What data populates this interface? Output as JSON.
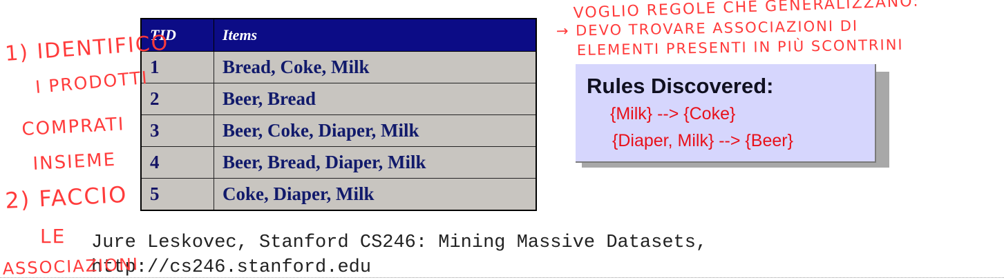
{
  "table": {
    "headers": [
      "TID",
      "Items"
    ],
    "rows": [
      [
        "1",
        "Bread, Coke, Milk"
      ],
      [
        "2",
        "Beer, Bread"
      ],
      [
        "3",
        "Beer, Coke, Diaper, Milk"
      ],
      [
        "4",
        "Beer, Bread, Diaper, Milk"
      ],
      [
        "5",
        "Coke, Diaper, Milk"
      ]
    ]
  },
  "rules_box": {
    "title": "Rules Discovered:",
    "rules": [
      "{Milk} --> {Coke}",
      "{Diaper, Milk} --> {Beer}"
    ],
    "rule_color": "#e8101a",
    "background": "#d6d6fd"
  },
  "citation": {
    "line1": "Jure Leskovec, Stanford CS246: Mining Massive Datasets,",
    "line2": "http://cs246.stanford.edu"
  },
  "handwriting": {
    "color": "#ff3b3b",
    "left_notes": [
      "1) IDENTIFICO",
      "I PRODOTTI",
      "COMPRATI",
      "INSIEME",
      "2) FACCIO",
      "LE",
      "ASSOCIAZIONI"
    ],
    "top_right_notes": [
      "VOGLIO REGOLE CHE GENERALIZZANO:",
      "→ DEVO TROVARE ASSOCIAZIONI DI",
      "ELEMENTI PRESENTI IN PIÙ SCONTRINI"
    ]
  }
}
